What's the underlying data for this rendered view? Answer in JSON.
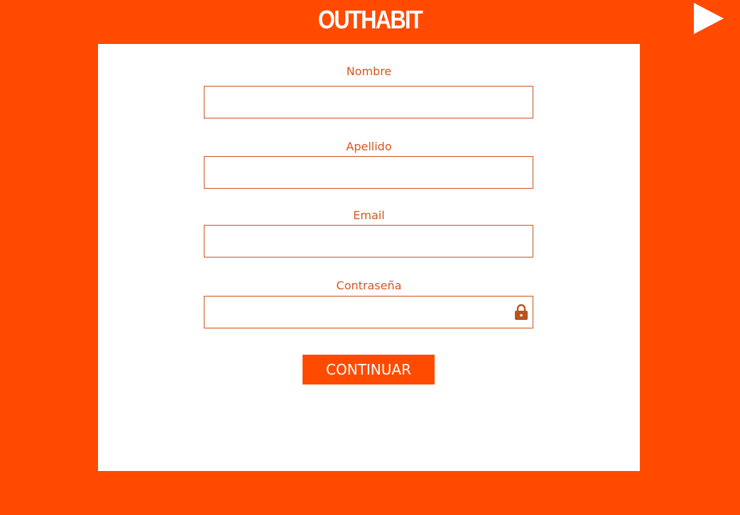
{
  "header": {
    "logo_text": "OUTHABIT",
    "play_icon": "play-icon"
  },
  "form": {
    "fields": [
      {
        "label": "Nombre",
        "value": "",
        "placeholder": ""
      },
      {
        "label": "Apellido",
        "value": "",
        "placeholder": ""
      },
      {
        "label": "Email",
        "value": "",
        "placeholder": ""
      },
      {
        "label": "Contraseña",
        "value": "",
        "placeholder": "",
        "icon": "lock-icon"
      }
    ],
    "submit_label": "CONTINUAR"
  },
  "colors": {
    "background": "#ff4a00",
    "card": "#ffffff",
    "label": "#d9541e",
    "input_border": "#c8531f",
    "lock_icon": "#b9541c"
  }
}
